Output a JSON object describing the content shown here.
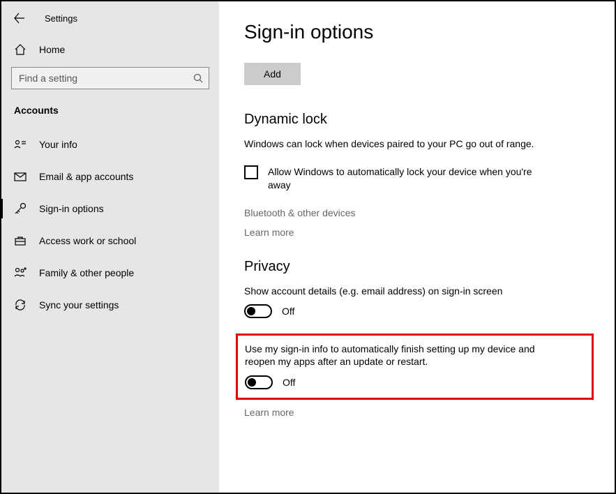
{
  "header": {
    "app_title": "Settings"
  },
  "sidebar": {
    "home_label": "Home",
    "search_placeholder": "Find a setting",
    "section_label": "Accounts",
    "items": [
      {
        "label": "Your info"
      },
      {
        "label": "Email & app accounts"
      },
      {
        "label": "Sign-in options"
      },
      {
        "label": "Access work or school"
      },
      {
        "label": "Family & other people"
      },
      {
        "label": "Sync your settings"
      }
    ]
  },
  "main": {
    "title": "Sign-in options",
    "add_label": "Add",
    "dynamic_lock": {
      "heading": "Dynamic lock",
      "desc": "Windows can lock when devices paired to your PC go out of range.",
      "checkbox_label": "Allow Windows to automatically lock your device when you're away",
      "bluetooth_link": "Bluetooth & other devices",
      "learn_more": "Learn more"
    },
    "privacy": {
      "heading": "Privacy",
      "show_details_label": "Show account details (e.g. email address) on sign-in screen",
      "toggle1_state": "Off",
      "use_signin_label": "Use my sign-in info to automatically finish setting up my device and reopen my apps after an update or restart.",
      "toggle2_state": "Off",
      "learn_more": "Learn more"
    }
  }
}
